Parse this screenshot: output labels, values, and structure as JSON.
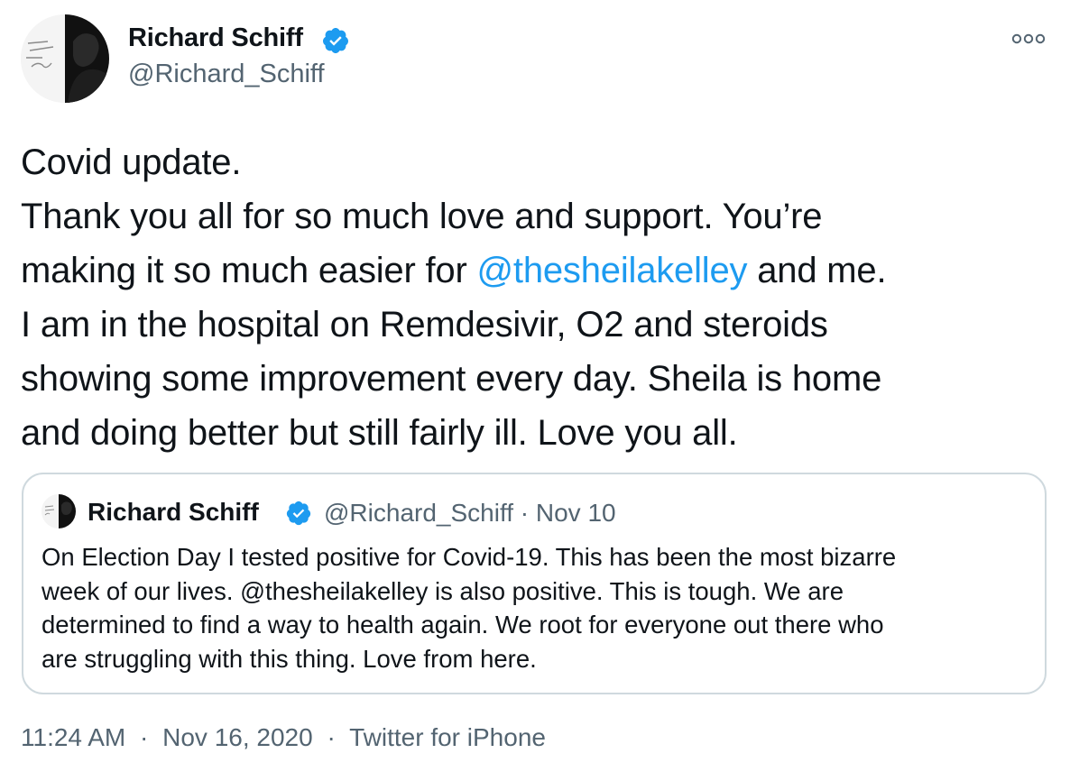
{
  "author": {
    "name": "Richard Schiff",
    "handle": "@Richard_Schiff"
  },
  "icons": {
    "verified": "verified-badge-icon",
    "more": "more-options-icon"
  },
  "colors": {
    "link": "#1d9bf0",
    "verified": "#1d9bf0",
    "secondary_text": "#536471"
  },
  "tweet": {
    "lines": [
      {
        "text": "Covid update."
      },
      {
        "text": "Thank you all for so much love and support. You’re"
      },
      {
        "before": "making it so much easier for ",
        "mention": "@thesheilakelley",
        "after": " and me."
      },
      {
        "text": "I am in the hospital on Remdesivir, O2 and steroids"
      },
      {
        "text": "showing some improvement every day. Sheila is home"
      },
      {
        "text": "and doing better but still fairly ill. Love you all."
      }
    ]
  },
  "quoted_tweet": {
    "name": "Richard Schiff",
    "handle": "@Richard_Schiff",
    "separator": "·",
    "date": "Nov 10",
    "lines": [
      "On Election Day I tested positive for Covid-19. This has been the most bizarre",
      "week of our lives. @thesheilakelley is also positive. This is tough. We are",
      "determined to find a way to health again. We root for everyone out there who",
      "are struggling with this thing. Love from here."
    ]
  },
  "footer": {
    "time": "11:24 AM",
    "separator": "·",
    "date": "Nov 16, 2020",
    "source": "Twitter for iPhone"
  }
}
